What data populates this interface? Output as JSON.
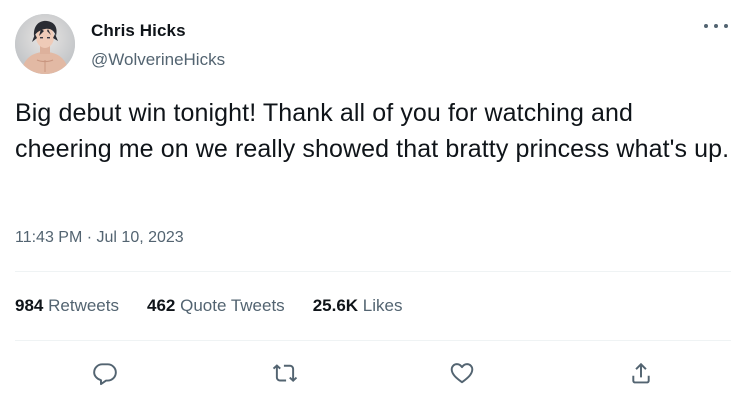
{
  "user": {
    "display_name": "Chris Hicks",
    "handle": "@WolverineHicks",
    "avatar_icon": "avatar-photo"
  },
  "tweet": {
    "text": "Big debut win tonight! Thank all of you for watching and cheering me on we really showed that bratty princess what's up.",
    "time": "11:43 PM",
    "separator": " · ",
    "date": "Jul 10, 2023"
  },
  "stats": {
    "retweets": {
      "count": "984",
      "label": "Retweets"
    },
    "quotes": {
      "count": "462",
      "label": "Quote Tweets"
    },
    "likes": {
      "count": "25.6K",
      "label": "Likes"
    }
  },
  "actions": [
    {
      "name": "reply",
      "icon": "reply-icon"
    },
    {
      "name": "retweet",
      "icon": "retweet-icon"
    },
    {
      "name": "like",
      "icon": "heart-icon"
    },
    {
      "name": "share",
      "icon": "share-icon"
    }
  ],
  "colors": {
    "text": "#0f1419",
    "secondary": "#536471",
    "divider": "#eff3f4"
  }
}
